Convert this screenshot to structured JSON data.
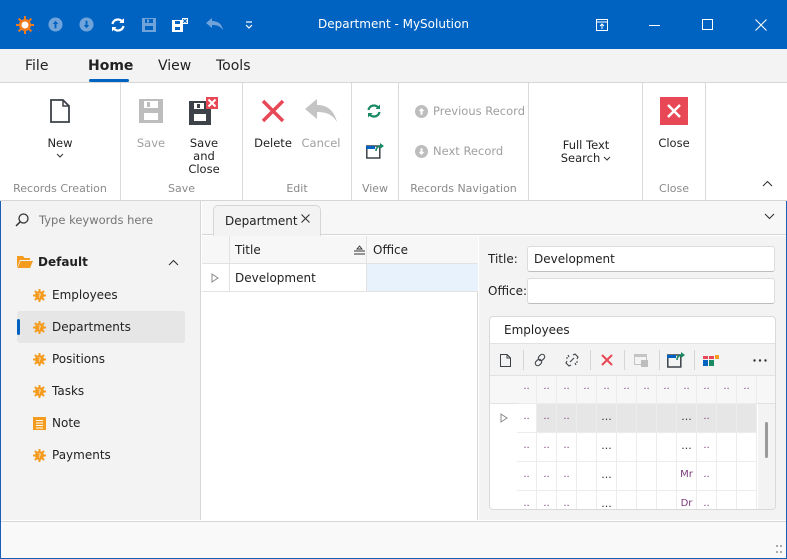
{
  "window": {
    "title": "Department - MySolution",
    "accent": "#0063c1",
    "quick_access": [
      "app-logo-icon",
      "previous-record-icon",
      "next-record-icon",
      "refresh-icon",
      "save-icon",
      "save-and-close-icon",
      "cancel-icon",
      "customize-qat-icon"
    ],
    "controls": [
      "restore-ribbon-icon",
      "minimize-icon",
      "maximize-icon",
      "close-icon"
    ]
  },
  "ribbon_tabs": [
    {
      "label": "File"
    },
    {
      "label": "Home",
      "active": true
    },
    {
      "label": "View"
    },
    {
      "label": "Tools"
    }
  ],
  "ribbon": {
    "groups": {
      "records_creation": {
        "label": "Records Creation",
        "new_label": "New"
      },
      "save": {
        "label": "Save",
        "save_label": "Save",
        "save_close_label_1": "Save and",
        "save_close_label_2": "Close"
      },
      "edit": {
        "label": "Edit",
        "delete_label": "Delete",
        "cancel_label": "Cancel"
      },
      "view": {
        "label": "View"
      },
      "records_navigation": {
        "label": "Records Navigation",
        "previous_label": "Previous Record",
        "next_label": "Next Record"
      },
      "search": {
        "label_1": "Full Text",
        "label_2": "Search"
      },
      "close": {
        "label": "Close",
        "close_label": "Close"
      }
    }
  },
  "sidebar": {
    "search_placeholder": "Type keywords here",
    "group_label": "Default",
    "items": [
      {
        "label": "Employees",
        "icon": "business-object-icon"
      },
      {
        "label": "Departments",
        "icon": "business-object-icon",
        "selected": true
      },
      {
        "label": "Positions",
        "icon": "business-object-icon"
      },
      {
        "label": "Tasks",
        "icon": "business-object-icon"
      },
      {
        "label": "Note",
        "icon": "note-icon"
      },
      {
        "label": "Payments",
        "icon": "business-object-icon"
      }
    ]
  },
  "document_tab": {
    "label": "Department"
  },
  "list": {
    "columns": [
      "Title",
      "Office"
    ],
    "rows": [
      {
        "title": "Development",
        "office": ""
      }
    ]
  },
  "detail": {
    "title_label": "Title:",
    "title_value": "Development",
    "office_label": "Office:",
    "office_value": "",
    "employees": {
      "label": "Employees",
      "toolbar": [
        "new-icon",
        "link-icon",
        "unlink-icon",
        "delete-icon",
        "show-in-popup-icon",
        "export-icon",
        "layout-icon",
        "more-icon"
      ],
      "header_cells": [
        "..",
        "..",
        "..",
        "..",
        "..",
        "..",
        "..",
        "..",
        "..",
        "..",
        "..",
        ".."
      ],
      "rows": [
        [
          "..",
          "..",
          "..",
          "",
          "...",
          "",
          "",
          "",
          "...",
          "..",
          "",
          ""
        ],
        [
          "..",
          "..",
          "..",
          "",
          "...",
          "",
          "",
          "",
          "...",
          "..",
          "",
          ""
        ],
        [
          "..",
          "..",
          "..",
          "",
          "...",
          "",
          "",
          "",
          "Mr",
          "..",
          "",
          ""
        ],
        [
          "..",
          "..",
          "..",
          "",
          "...",
          "",
          "",
          "",
          "Dr",
          "..",
          "",
          ""
        ]
      ]
    }
  }
}
